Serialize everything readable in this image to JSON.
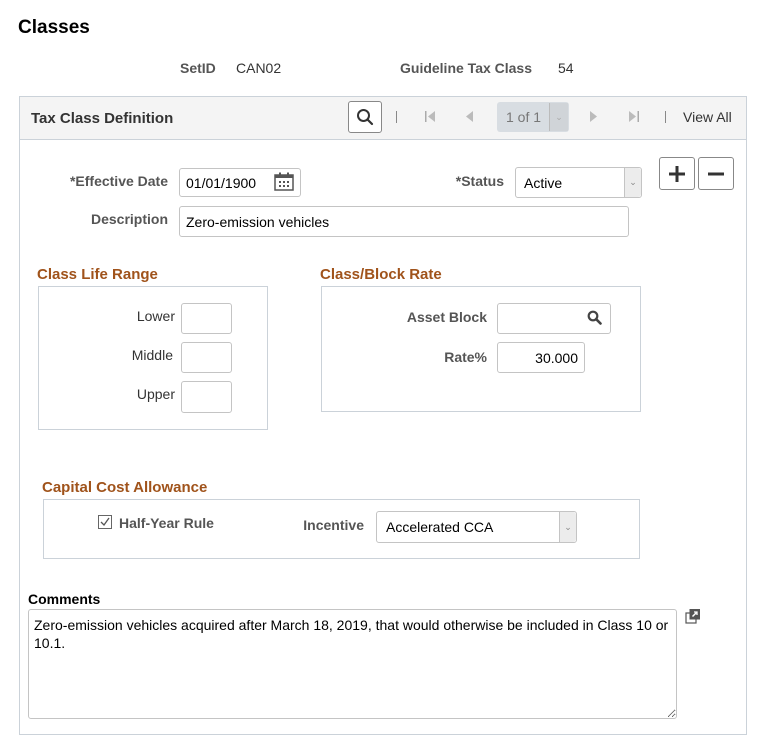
{
  "page": {
    "title": "Classes"
  },
  "header": {
    "setid_label": "SetID",
    "setid_value": "CAN02",
    "tax_class_label": "Guideline Tax Class",
    "tax_class_value": "54"
  },
  "grid": {
    "title": "Tax Class Definition",
    "pager_text": "1 of 1",
    "view_all_label": "View All",
    "icons": {
      "search": "search-icon",
      "first": "first-page-icon",
      "prev": "previous-icon",
      "next": "next-icon",
      "last": "last-page-icon"
    }
  },
  "form": {
    "effective_date_label": "*Effective Date",
    "effective_date_value": "01/01/1900",
    "status_label": "*Status",
    "status_value": "Active",
    "description_label": "Description",
    "description_value": "Zero-emission vehicles",
    "add_row_label": "+",
    "delete_row_label": "−"
  },
  "class_life_range": {
    "title": "Class Life Range",
    "lower_label": "Lower",
    "lower_value": "",
    "middle_label": "Middle",
    "middle_value": "",
    "upper_label": "Upper",
    "upper_value": ""
  },
  "class_block_rate": {
    "title": "Class/Block Rate",
    "asset_block_label": "Asset Block",
    "asset_block_value": "",
    "rate_label": "Rate%",
    "rate_value": "30.000"
  },
  "cca": {
    "title": "Capital Cost Allowance",
    "half_year_label": "Half-Year Rule",
    "half_year_checked": true,
    "incentive_label": "Incentive",
    "incentive_value": "Accelerated CCA"
  },
  "comments": {
    "label": "Comments",
    "value": "Zero-emission vehicles acquired after March 18, 2019, that would otherwise be included in Class 10 or 10.1."
  }
}
